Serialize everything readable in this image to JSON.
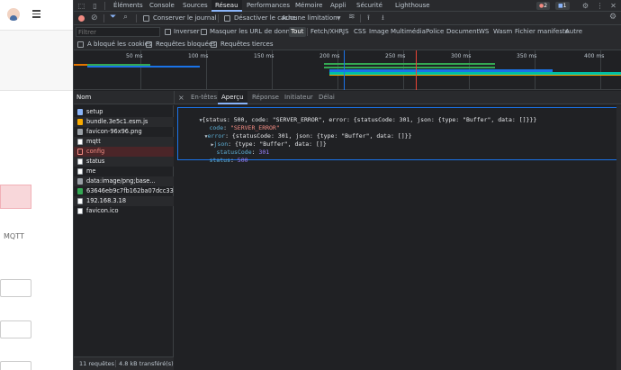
{
  "devtools": {
    "tabs": [
      "Éléments",
      "Console",
      "Sources",
      "Réseau",
      "Performances",
      "Mémoire",
      "Appli",
      "Sécurité",
      "Lighthouse"
    ],
    "active_tab": "Réseau",
    "errors_count": "2",
    "messages_count": "1"
  },
  "toolbar": {
    "preserve_log": "Conserver le journal",
    "disable_cache": "Désactiver le cache",
    "throttling": "Aucune limitation"
  },
  "filter": {
    "placeholder": "Filtrer",
    "invert": "Inverser",
    "hide_data_urls": "Masquer les URL de données",
    "types": [
      "Tout",
      "Fetch/XHR",
      "JS",
      "CSS",
      "Image",
      "Multimédia",
      "Police",
      "Document",
      "WS",
      "Wasm",
      "Fichier manifeste",
      "Autre"
    ],
    "blocked_cookies": "A bloqué les cookies",
    "blocked_requests": "Requêtes bloquées",
    "third_party": "Requêtes tierces"
  },
  "timeline": {
    "ticks": [
      "50 ms",
      "100 ms",
      "150 ms",
      "200 ms",
      "250 ms",
      "300 ms",
      "350 ms",
      "400 ms"
    ]
  },
  "requests": {
    "header": "Nom",
    "items": [
      {
        "name": "setup",
        "type": "doc"
      },
      {
        "name": "bundle.3e5c1.esm.js",
        "type": "js"
      },
      {
        "name": "favicon-96x96.png",
        "type": "img"
      },
      {
        "name": "mqtt",
        "type": "plain"
      },
      {
        "name": "config",
        "type": "err"
      },
      {
        "name": "status",
        "type": "plain"
      },
      {
        "name": "me",
        "type": "plain"
      },
      {
        "name": "data:image/png;base...",
        "type": "img"
      },
      {
        "name": "63646eb9c7fb162ba07dcc333...",
        "type": "ws"
      },
      {
        "name": "192.168.3.18",
        "type": "plain"
      },
      {
        "name": "favicon.ico",
        "type": "plain"
      }
    ]
  },
  "detail_tabs": [
    "En-têtes",
    "Aperçu",
    "Réponse",
    "Initiateur",
    "Délai"
  ],
  "active_detail_tab": "Aperçu",
  "preview": {
    "line1": "{status: 500, code: \"SERVER_ERROR\", error: {statusCode: 301, json: {type: \"Buffer\", data: []}}}",
    "code_key": "code",
    "code_val": "\"SERVER_ERROR\"",
    "error_key": "error",
    "error_val": "{statusCode: 301, json: {type: \"Buffer\", data: []}}",
    "json_key": "json",
    "json_val": "{type: \"Buffer\", data: []}",
    "statusCode_key": "statusCode",
    "statusCode_val": "301",
    "status_key": "status",
    "status_val": "500"
  },
  "statusbar": {
    "requests": "11 requêtes",
    "transferred": "4.8 kB transféré(s)"
  },
  "app": {
    "mqtt_label": "MQTT"
  }
}
